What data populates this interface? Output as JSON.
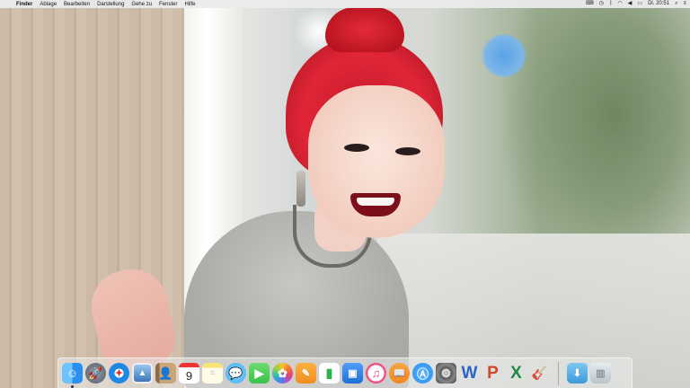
{
  "menubar": {
    "apple_glyph": "",
    "items": [
      "Finder",
      "Ablage",
      "Bearbeiten",
      "Darstellung",
      "Gehe zu",
      "Fenster",
      "Hilfe"
    ],
    "status": {
      "clock": "Di. 20:51"
    }
  },
  "dock": {
    "calendar_day": "9",
    "word_letter": "W",
    "powerpoint_letter": "P",
    "excel_letter": "X"
  },
  "colors": {
    "finder": "#2a8ff0",
    "safari": "#1e88e5",
    "messages": "#3fb0f5",
    "facetime": "#39c24a",
    "itunes": "#f24e84",
    "ibooks": "#f2871e",
    "appstore": "#1f8ef1",
    "word": "#2b63c6",
    "powerpoint": "#d24726",
    "excel": "#1f8a48"
  }
}
